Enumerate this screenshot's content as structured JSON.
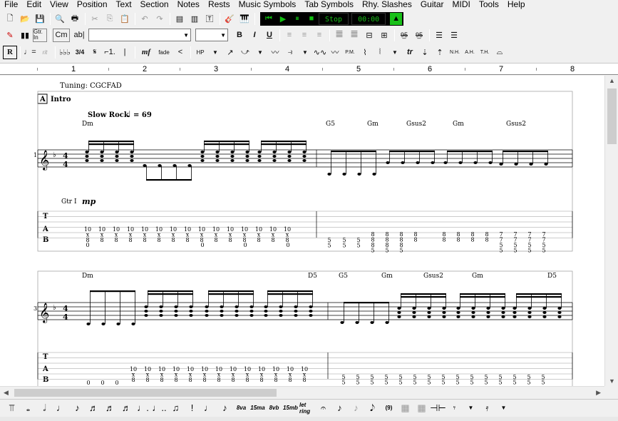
{
  "menu": [
    "File",
    "Edit",
    "View",
    "Position",
    "Text",
    "Section",
    "Notes",
    "Rests",
    "Music Symbols",
    "Tab Symbols",
    "Rhy. Slashes",
    "Guitar",
    "MIDI",
    "Tools",
    "Help"
  ],
  "toolbar": {
    "transport_status": "Stop",
    "transport_time": "00:00",
    "chord_symbol_label": "Cm",
    "text_tool_label": "ab|",
    "bold_label": "B",
    "italic_label": "I",
    "underline_label": "U",
    "guitar_inlay_label": "Gtr. In",
    "rehearsal_label": "R",
    "time_sig_label": "3/4",
    "dynamics_label": "mf",
    "fade_label": "fade",
    "hp_label": "HP",
    "pm_label": "P.M.",
    "trill_label": "tr",
    "nh_label": "N.H.",
    "ah_label": "A.H.",
    "th_label": "T.H."
  },
  "ruler": {
    "numbers": [
      "1",
      "2",
      "3",
      "4",
      "5",
      "6",
      "7",
      "8"
    ]
  },
  "score": {
    "tuning": "Tuning: CGCFAD",
    "section_letter": "A",
    "section_name": "Intro",
    "tempo_text": "Slow Rock",
    "tempo_value": "= 69",
    "guitar_label": "Gtr I",
    "dynamic": "mp",
    "system1_number": "1",
    "system2_number": "3",
    "tab_letters": [
      "T",
      "A",
      "B"
    ],
    "system1_chords": [
      "Dm",
      "G5",
      "Gm",
      "Gsus2",
      "Gm",
      "Gsus2"
    ],
    "system2_chords": [
      "Dm",
      "D5",
      "G5",
      "Gm",
      "Gsus2",
      "Gm",
      "D5"
    ],
    "tab_fret_value": "10",
    "tab_mute": "x",
    "tab_fret_eight": "8",
    "tab_fret_zero": "0",
    "tab_fret_five": "5",
    "tab_fret_seven": "7"
  },
  "bottom": {
    "eighth_va": "8va",
    "fifteen_ma": "15ma",
    "eight_vb": "8vb",
    "fifteen_mb": "15mb",
    "let_ring": "let ring",
    "triplet": "(9)"
  }
}
